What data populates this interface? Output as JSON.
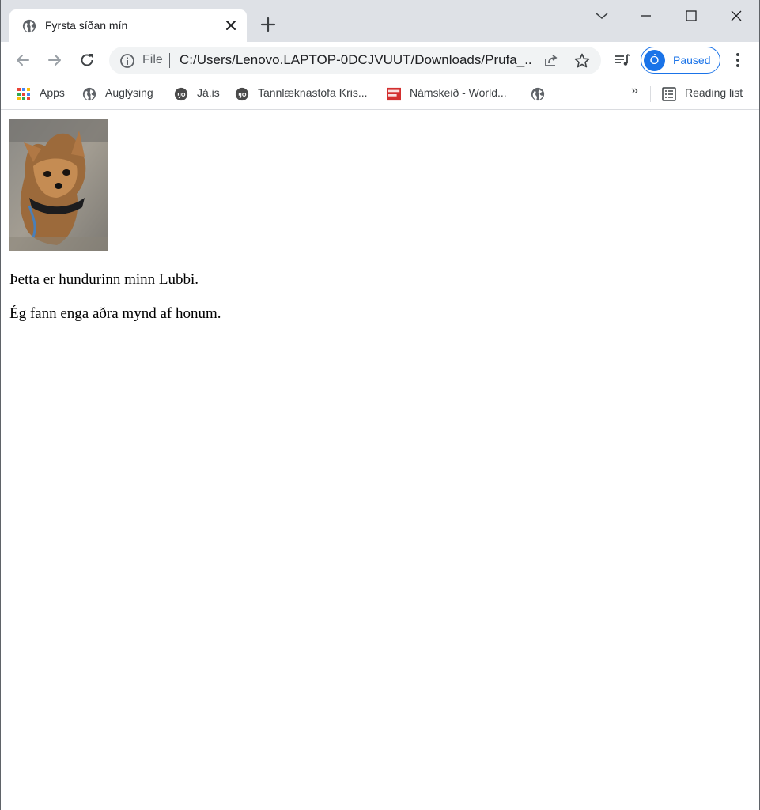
{
  "tab": {
    "title": "Fyrsta síðan mín"
  },
  "toolbar": {
    "scheme": "File",
    "url": "C:/Users/Lenovo.LAPTOP-0DCJVUUT/Downloads/Prufa_...",
    "profile_initial": "Ó",
    "profile_status": "Paused"
  },
  "bookmarks": {
    "items": [
      {
        "label": "Apps",
        "icon": "apps-grid-icon"
      },
      {
        "label": "Auglýsing",
        "icon": "globe-icon"
      },
      {
        "label": "Já.is",
        "icon": "ja-icon"
      },
      {
        "label": "Tannlæknastofa Kris...",
        "icon": "ja-icon"
      },
      {
        "label": "Námskeið - World...",
        "icon": "world-class-icon"
      },
      {
        "label": "",
        "icon": "globe-icon"
      }
    ],
    "overflow_label": "»",
    "reading_list_label": "Reading list"
  },
  "page": {
    "paragraphs": [
      "Þetta er hundurinn minn Lubbi.",
      "Ég fann enga aðra mynd af honum."
    ]
  },
  "colors": {
    "accent": "#1a73e8",
    "tabstrip": "#dee1e6",
    "omnibox": "#f1f3f4"
  }
}
